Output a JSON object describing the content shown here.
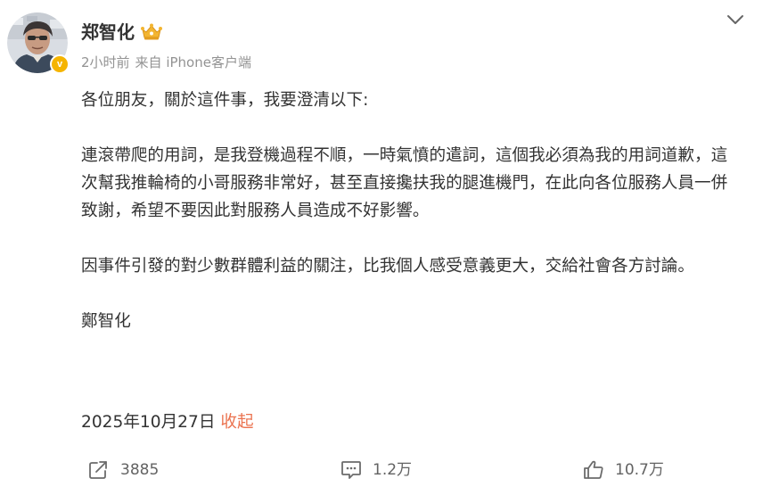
{
  "user": {
    "name": "郑智化",
    "verified_mark": "v",
    "badge_icon": "crown-icon",
    "accent_color": "#f5b400"
  },
  "meta": {
    "time": "2小时前",
    "source": "来自 iPhone客户端"
  },
  "post": {
    "paragraphs": [
      "各位朋友，關於這件事，我要澄清以下:",
      "連滾帶爬的用詞，是我登機過程不順，一時氣憤的遣詞，這個我必須為我的用詞道歉，這次幫我推輪椅的小哥服務非常好，甚至直接攙扶我的腿進機門，在此向各位服務人員一併致謝，希望不要因此對服務人員造成不好影響。",
      "因事件引發的對少數群體利益的關注，比我個人感受意義更大，交給社會各方討論。",
      "鄭智化"
    ],
    "date": "2025年10月27日",
    "collapse_label": "收起",
    "link_color": "#eb7350"
  },
  "actions": {
    "repost_count": "3885",
    "comment_count": "1.2万",
    "like_count": "10.7万"
  }
}
